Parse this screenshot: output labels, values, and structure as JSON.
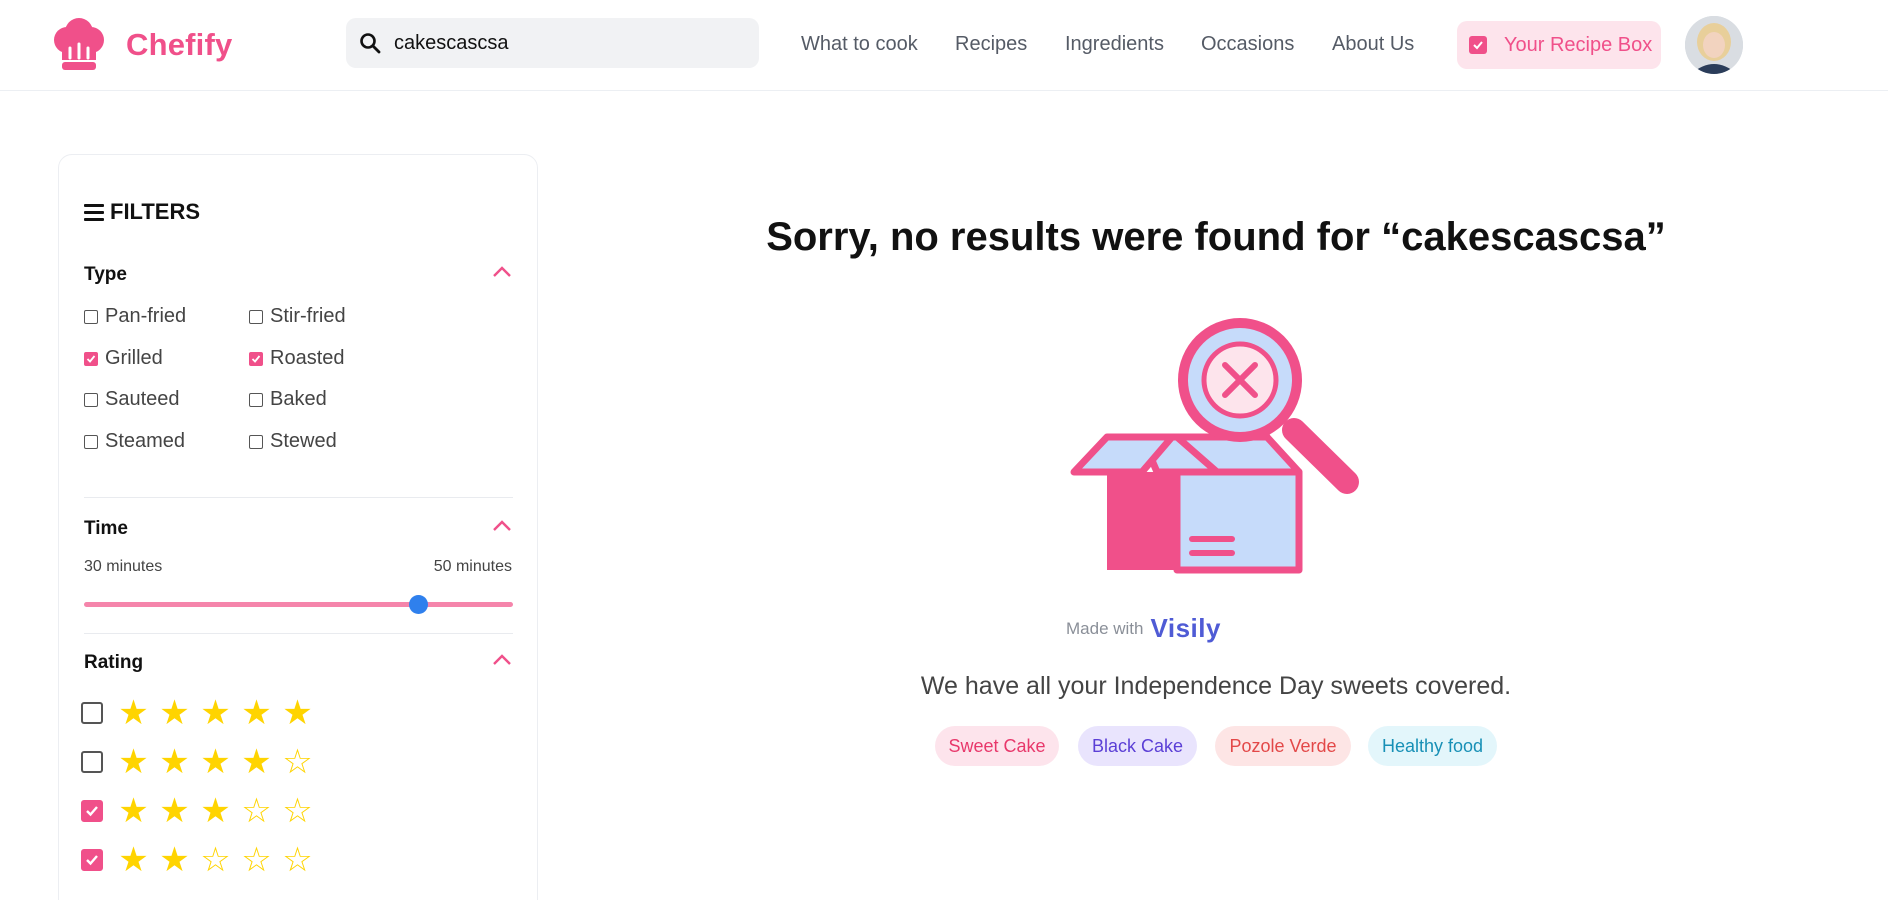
{
  "app": {
    "name": "Chefify",
    "brand_color": "#f0508a"
  },
  "search": {
    "value": "cakescascsa",
    "icon": "search-icon"
  },
  "nav": {
    "items": [
      {
        "label": "What to cook"
      },
      {
        "label": "Recipes"
      },
      {
        "label": "Ingredients"
      },
      {
        "label": "Occasions"
      },
      {
        "label": "About Us"
      }
    ],
    "recipe_box_label": "Your Recipe Box",
    "recipe_box_checked": true
  },
  "filters": {
    "title": "FILTERS",
    "type": {
      "title": "Type",
      "options": [
        {
          "label": "Pan-fried",
          "checked": false
        },
        {
          "label": "Stir-fried",
          "checked": false
        },
        {
          "label": "Grilled",
          "checked": true
        },
        {
          "label": "Roasted",
          "checked": true
        },
        {
          "label": "Sauteed",
          "checked": false
        },
        {
          "label": "Baked",
          "checked": false
        },
        {
          "label": "Steamed",
          "checked": false
        },
        {
          "label": "Stewed",
          "checked": false
        }
      ]
    },
    "time": {
      "title": "Time",
      "min_label": "30 minutes",
      "max_label": "50 minutes",
      "slider_fraction": 0.78
    },
    "rating": {
      "title": "Rating",
      "rows": [
        {
          "stars": 5,
          "checked": false
        },
        {
          "stars": 4,
          "checked": false
        },
        {
          "stars": 3,
          "checked": true
        },
        {
          "stars": 2,
          "checked": true
        }
      ]
    }
  },
  "results": {
    "headline": "Sorry, no results were found for “cakescascsa”",
    "made_with": "Made with",
    "made_with_brand": "Visily",
    "subtext": "We have all your Independence Day sweets covered.",
    "tags": [
      {
        "label": "Sweet Cake",
        "bg": "#fde4ec",
        "color": "#e8386b"
      },
      {
        "label": "Black Cake",
        "bg": "#e9e4fd",
        "color": "#5b3fd6"
      },
      {
        "label": "Pozole Verde",
        "bg": "#fde5e5",
        "color": "#e34848"
      },
      {
        "label": "Healthy food",
        "bg": "#e3f6fb",
        "color": "#1890b6"
      }
    ]
  },
  "colors": {
    "accent": "#f0508a",
    "star": "#ffd400",
    "slider_thumb": "#2f80ed"
  }
}
